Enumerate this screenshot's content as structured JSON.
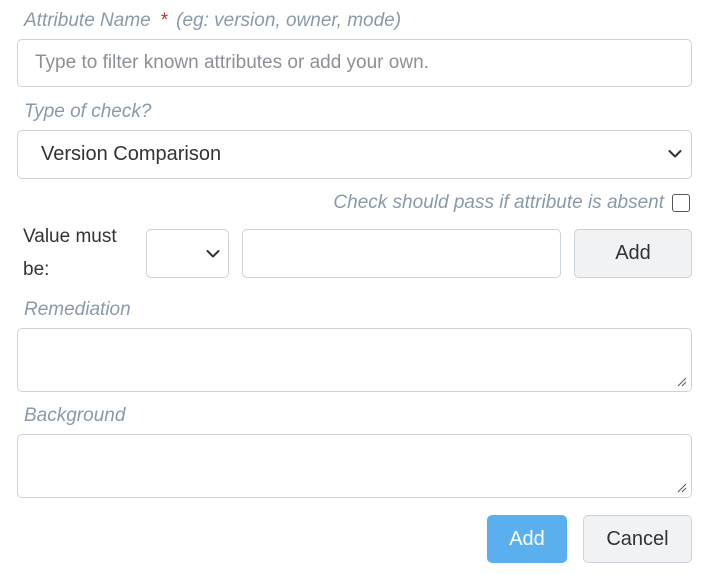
{
  "attribute_name": {
    "label": "Attribute Name",
    "required_marker": "*",
    "hint": "(eg: version, owner, mode)",
    "placeholder": "Type to filter known attributes or add your own.",
    "value": ""
  },
  "type_of_check": {
    "label": "Type of check?",
    "selected": "Version Comparison"
  },
  "absent_pass": {
    "label": "Check should pass if attribute is absent",
    "checked": false
  },
  "value_must_be": {
    "label_line1": "Value must",
    "label_line2": "be:",
    "operator_selected": "",
    "value": "",
    "add_label": "Add"
  },
  "remediation": {
    "label": "Remediation",
    "value": ""
  },
  "background": {
    "label": "Background",
    "value": ""
  },
  "actions": {
    "submit_label": "Add",
    "cancel_label": "Cancel"
  },
  "icons": {
    "dropdown": "chevron-down-icon",
    "resize": "resize-handle-icon"
  },
  "colors": {
    "label": "#8a99aa",
    "required": "#b03a2e",
    "primary_button": "#5ab0ee",
    "border": "#cdd2d8"
  }
}
